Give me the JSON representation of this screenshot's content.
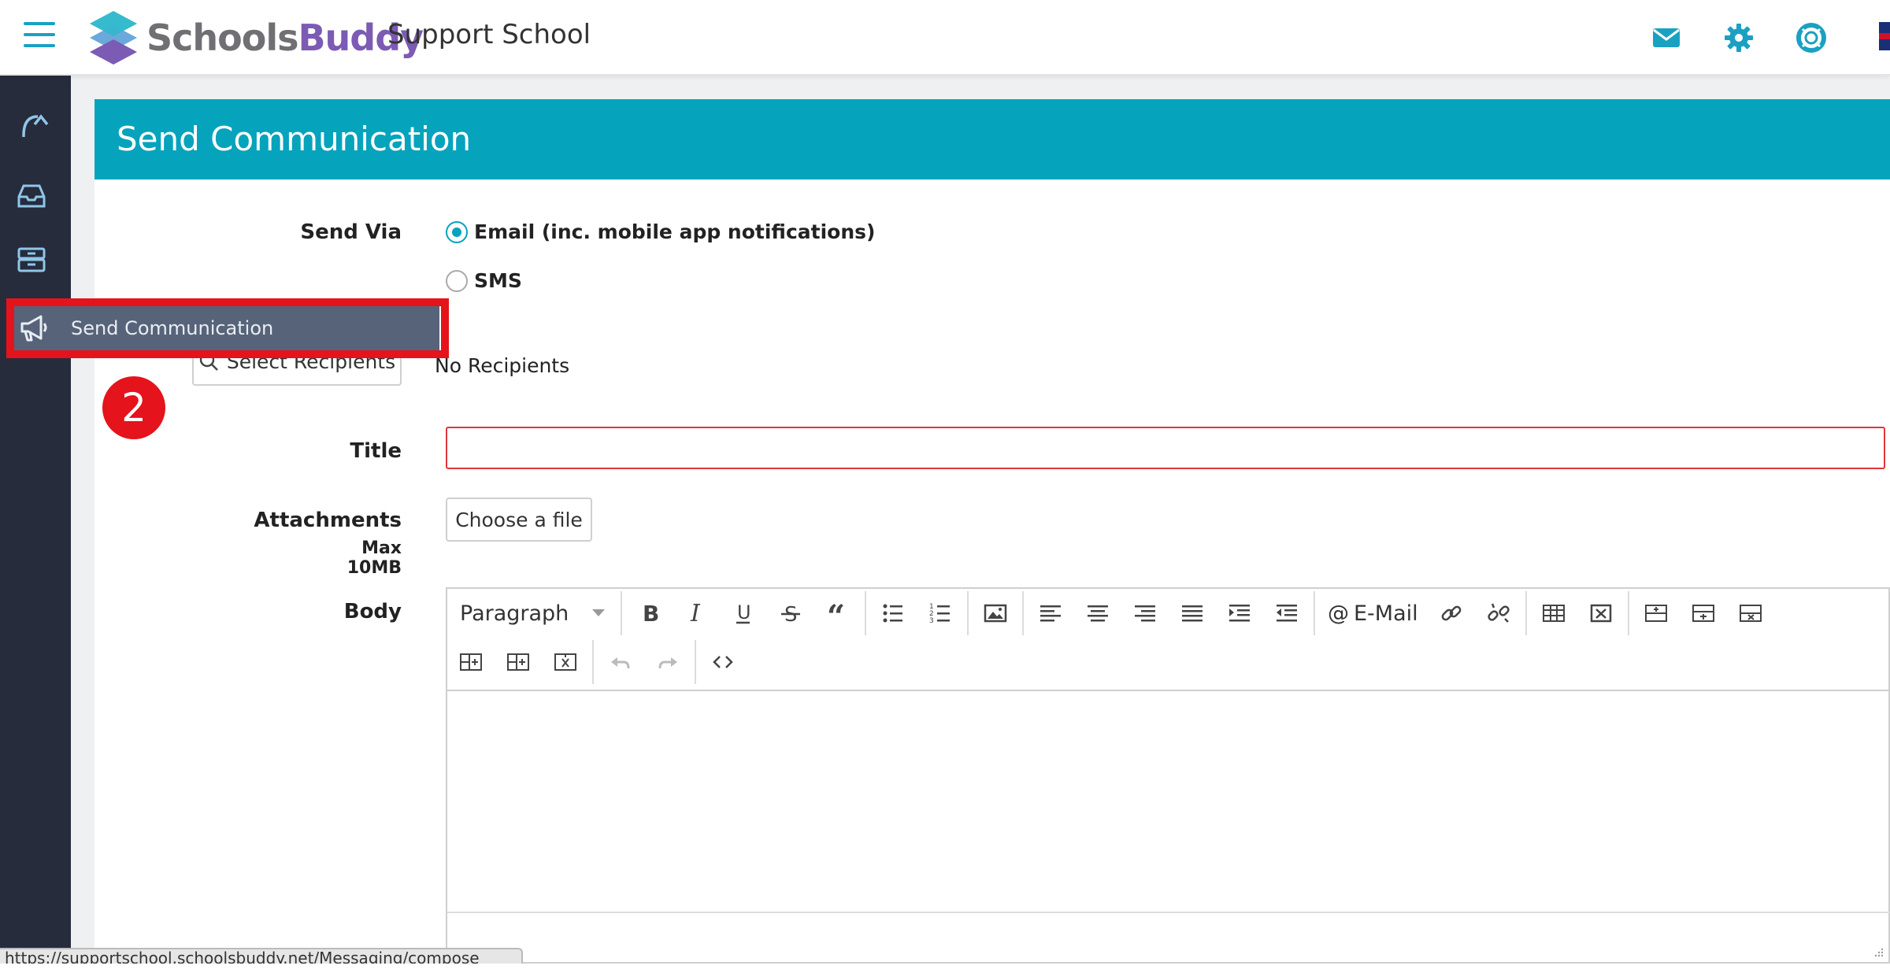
{
  "header": {
    "logo_part1": "Schools",
    "logo_part2": "Buddy",
    "school_name": "Support School"
  },
  "sidebar_tooltip": "Send Communication",
  "step_number": "2",
  "page": {
    "title": "Send Communication",
    "send_via_label": "Send Via",
    "send_via_options": [
      {
        "label": "Email (inc. mobile app notifications)",
        "checked": true
      },
      {
        "label": "SMS",
        "checked": false
      }
    ],
    "select_recipients_label": "Select Recipients",
    "recipients_status": "No Recipients",
    "title_label": "Title",
    "title_value": "",
    "attachments_label": "Attachments",
    "attachments_max": "Max 10MB",
    "choose_file_label": "Choose a file",
    "body_label": "Body"
  },
  "editor": {
    "format_value": "Paragraph",
    "mail_label": "E-Mail"
  },
  "status_bar_url": "https://supportschool.schoolsbuddy.net/Messaging/compose",
  "colors": {
    "accent": "#06a3bd",
    "sidebar": "#262c3c",
    "highlight": "#e5131b",
    "logo_purple": "#7b5bb3"
  }
}
